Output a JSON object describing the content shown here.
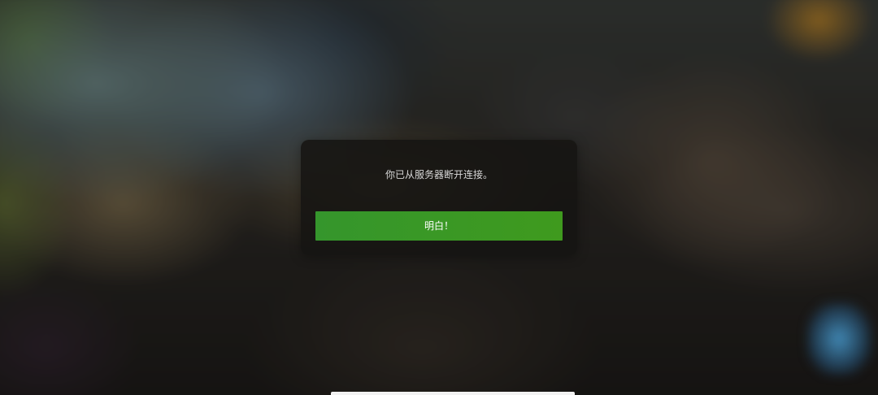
{
  "dialog": {
    "message": "你已从服务器断开连接。",
    "confirm_label": "明白！"
  },
  "colors": {
    "button_green": "#389a24",
    "dialog_background": "#161412",
    "message_text": "#d8d8d8"
  }
}
